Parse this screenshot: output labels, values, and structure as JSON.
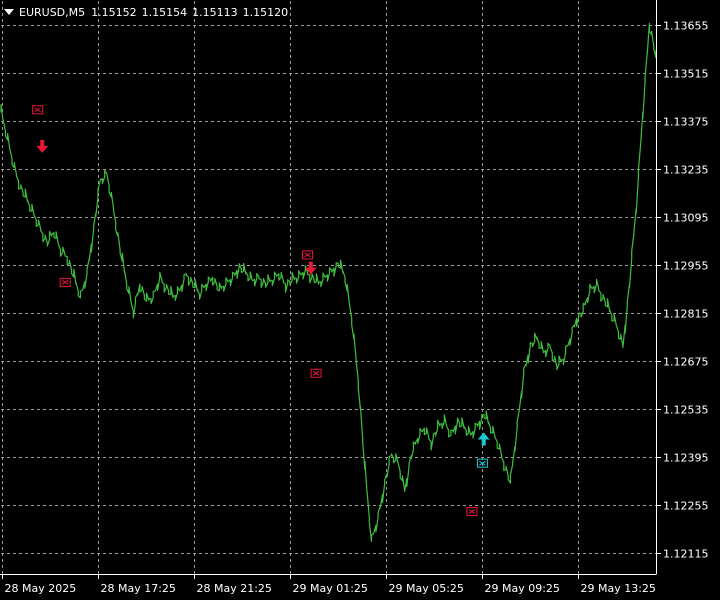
{
  "window": {
    "symbol": "EURUSD,M5",
    "quotes": [
      "1.15152",
      "1.15154",
      "1.15113",
      "1.15120"
    ]
  },
  "colors": {
    "background": "#000000",
    "grid": "#9a9a9a",
    "price_line": "#3fbf3f",
    "sell_marker": "#e8173a",
    "buy_marker": "#1ec8d2",
    "axis_text": "#ffffff"
  },
  "chart_data": {
    "type": "line",
    "symbol": "EURUSD",
    "timeframe": "M5",
    "ylim": [
      1.12055,
      1.13725
    ],
    "y_ticks": [
      "1.13655",
      "1.13515",
      "1.13375",
      "1.13235",
      "1.13095",
      "1.12955",
      "1.12815",
      "1.12675",
      "1.12535",
      "1.12395",
      "1.12255",
      "1.12115"
    ],
    "x_ticks": [
      "28 May 2025",
      "28 May 17:25",
      "28 May 21:25",
      "29 May 01:25",
      "29 May 05:25",
      "29 May 09:25",
      "29 May 13:25"
    ],
    "grid": true,
    "series": [
      {
        "values": [
          1.134,
          1.1332,
          1.1324,
          1.1318,
          1.1314,
          1.131,
          1.1306,
          1.1302,
          1.1305,
          1.13,
          1.1298,
          1.1292,
          1.1286,
          1.1293,
          1.1306,
          1.132,
          1.1322,
          1.1312,
          1.13,
          1.129,
          1.1282,
          1.129,
          1.1285,
          1.1286,
          1.1292,
          1.1289,
          1.1286,
          1.1288,
          1.1293,
          1.129,
          1.1287,
          1.129,
          1.1292,
          1.1288,
          1.129,
          1.1292,
          1.1295,
          1.1293,
          1.1291,
          1.1292,
          1.129,
          1.1291,
          1.1293,
          1.129,
          1.1291,
          1.1292,
          1.1294,
          1.1292,
          1.129,
          1.1292,
          1.1294,
          1.1296,
          1.1292,
          1.128,
          1.1262,
          1.1236,
          1.1215,
          1.1222,
          1.1232,
          1.124,
          1.1238,
          1.123,
          1.124,
          1.1245,
          1.1248,
          1.1244,
          1.1248,
          1.125,
          1.1246,
          1.125,
          1.1248,
          1.1246,
          1.1249,
          1.1252,
          1.1248,
          1.1244,
          1.1238,
          1.1232,
          1.1248,
          1.1264,
          1.1272,
          1.1274,
          1.127,
          1.1272,
          1.1266,
          1.1268,
          1.1274,
          1.128,
          1.1282,
          1.1288,
          1.129,
          1.1286,
          1.1282,
          1.1278,
          1.1272,
          1.129,
          1.1312,
          1.134,
          1.1366,
          1.1356
        ]
      }
    ],
    "markers": [
      {
        "kind": "sell-entry",
        "x": 0.056,
        "y": 1.13408
      },
      {
        "kind": "sell-arrow",
        "x": 0.063,
        "y": 1.133
      },
      {
        "kind": "exit",
        "x": 0.098,
        "y": 1.12905
      },
      {
        "kind": "sell-entry",
        "x": 0.468,
        "y": 1.12985
      },
      {
        "kind": "sell-arrow",
        "x": 0.473,
        "y": 1.12945
      },
      {
        "kind": "exit",
        "x": 0.481,
        "y": 1.1264
      },
      {
        "kind": "buy-arrow",
        "x": 0.737,
        "y": 1.1245
      },
      {
        "kind": "buy-entry",
        "x": 0.735,
        "y": 1.12378
      },
      {
        "kind": "exit",
        "x": 0.719,
        "y": 1.12237
      }
    ]
  }
}
